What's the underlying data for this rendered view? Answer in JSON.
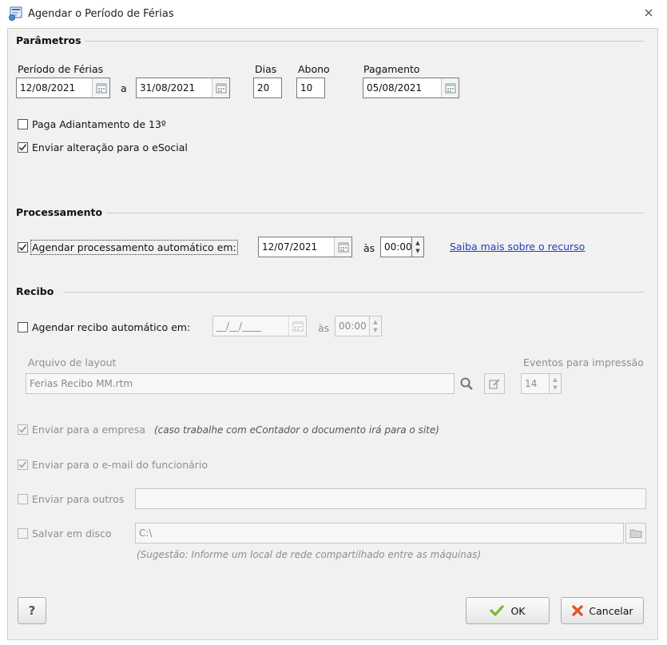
{
  "window": {
    "title": "Agendar o Período de Férias",
    "close_glyph": "#"
  },
  "parametros": {
    "section_label": "Parâmetros",
    "periodo_label": "Período de Férias",
    "data_inicio": "12/08/2021",
    "separator_a": "a",
    "data_fim": "31/08/2021",
    "dias_label": "Dias",
    "dias_value": "20",
    "abono_label": "Abono",
    "abono_value": "10",
    "pagamento_label": "Pagamento",
    "pagamento_value": "05/08/2021",
    "adiantamento_label": "Paga Adiantamento de 13º",
    "adiantamento_checked": false,
    "esocial_label": "Enviar alteração para o eSocial",
    "esocial_checked": true
  },
  "processamento": {
    "section_label": "Processamento",
    "agendar_label": "Agendar processamento automático em:",
    "agendar_checked": true,
    "data": "12/07/2021",
    "as_label": "às",
    "hora": "00:00",
    "link_text": "Saiba mais sobre o recurso"
  },
  "recibo": {
    "section_label": "Recibo",
    "agendar_label": "Agendar recibo automático em:",
    "agendar_checked": false,
    "data": "__/__/____",
    "as_label": "às",
    "hora": "00:00",
    "layout_label": "Arquivo de layout",
    "layout_value": "Ferias Recibo MM.rtm",
    "eventos_label": "Eventos para impressão",
    "eventos_value": "14",
    "enviar_empresa_label": "Enviar para a empresa",
    "enviar_empresa_note": "(caso trabalhe com eContador o documento irá para o site)",
    "enviar_empresa_checked": true,
    "enviar_email_label": "Enviar para o e-mail do funcionário",
    "enviar_email_checked": true,
    "enviar_outros_label": "Enviar para outros",
    "enviar_outros_checked": false,
    "enviar_outros_value": "",
    "salvar_disco_label": "Salvar em disco",
    "salvar_disco_checked": false,
    "salvar_disco_value": "C:\\",
    "sugestao": "(Sugestão: Informe um local de rede compartilhado entre as máquinas)"
  },
  "footer": {
    "help_label": "?",
    "ok_label": "OK",
    "cancel_label": "Cancelar"
  },
  "colors": {
    "ok_check": "#7cb82f",
    "cancel_x": "#e0562b",
    "link": "#1f3fb8"
  }
}
